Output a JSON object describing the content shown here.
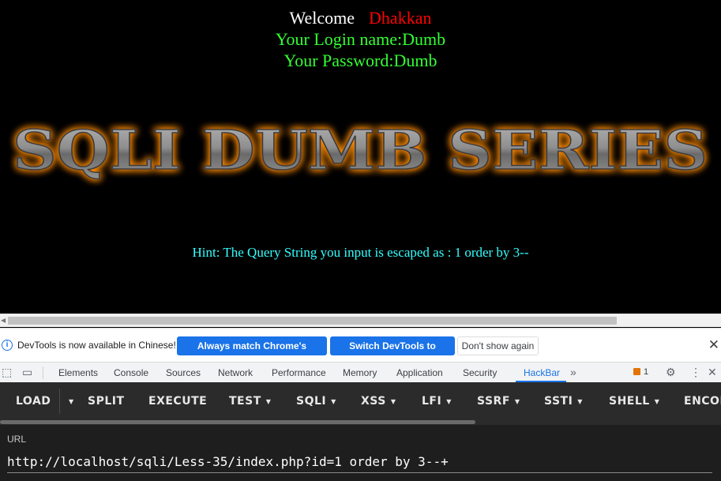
{
  "page": {
    "welcome_label": "Welcome",
    "welcome_user": "Dhakkan",
    "login_line": "Your Login name:Dumb",
    "password_line": "Your Password:Dumb",
    "banner_text": "SQLI DUMB SERIES",
    "hint": "Hint: The Query String you input is escaped as : 1 order by 3--"
  },
  "infobar": {
    "message": "DevTools is now available in Chinese!",
    "match_button": "Always match Chrome's language",
    "switch_button": "Switch DevTools to Chinese",
    "dont_show_button": "Don't show again"
  },
  "devtools_tabs": [
    {
      "label": "Elements"
    },
    {
      "label": "Console"
    },
    {
      "label": "Sources"
    },
    {
      "label": "Network"
    },
    {
      "label": "Performance"
    },
    {
      "label": "Memory"
    },
    {
      "label": "Application"
    },
    {
      "label": "Security"
    },
    {
      "label": "HackBar",
      "active": true
    }
  ],
  "devtools_icons": {
    "inspect": "inspect-element-icon",
    "device": "device-toolbar-icon",
    "more_tabs": "chevron-double-right-icon",
    "issues_count": "1",
    "settings": "gear-icon",
    "menu": "kebab-menu-icon",
    "close": "close-icon"
  },
  "hackbar": {
    "load": "LOAD",
    "split": "SPLIT",
    "execute": "EXECUTE",
    "test": "TEST",
    "sqli": "SQLI",
    "xss": "XSS",
    "lfi": "LFI",
    "ssrf": "SSRF",
    "ssti": "SSTI",
    "shell": "SHELL",
    "encode": "ENCOD",
    "url_label": "URL",
    "url_value": "http://localhost/sqli/Less-35/index.php?id=1 order by 3--+"
  },
  "colors": {
    "welcome": "#ffffff",
    "username": "#ff0000",
    "credentials": "#33ff33",
    "hint": "#33ffff",
    "banner_glow": "#ff8c00",
    "accent": "#1a73e8"
  }
}
